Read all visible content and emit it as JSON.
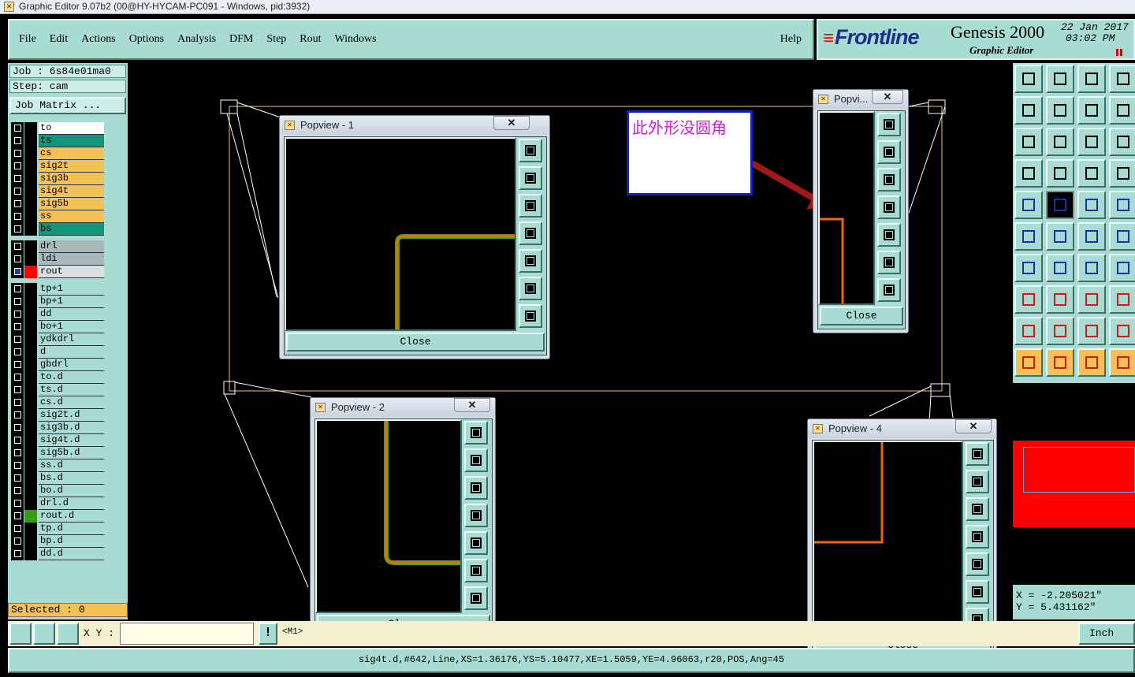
{
  "window_title": "Graphic Editor 9.07b2 (00@HY-HYCAM-PC091 - Windows, pid:3932)",
  "menu": [
    "File",
    "Edit",
    "Actions",
    "Options",
    "Analysis",
    "DFM",
    "Step",
    "Rout",
    "Windows"
  ],
  "help_label": "Help",
  "brand": {
    "logo": "Frontline",
    "product": "Genesis 2000",
    "subtitle": "Graphic Editor",
    "date": "22 Jan 2017",
    "time": "03:02 PM"
  },
  "job": {
    "job_label": "Job : 6s84e01ma0",
    "step_label": "Step: cam",
    "matrix_button": "Job Matrix ..."
  },
  "layers": [
    {
      "name": "to",
      "color": "#ffffff",
      "swatch": "#000000"
    },
    {
      "name": "ts",
      "color": "#14947a",
      "swatch": "#000000"
    },
    {
      "name": "cs",
      "color": "#f5c054",
      "swatch": "#000000"
    },
    {
      "name": "sig2t",
      "color": "#f5c054",
      "swatch": "#000000"
    },
    {
      "name": "sig3b",
      "color": "#f5c054",
      "swatch": "#000000"
    },
    {
      "name": "sig4t",
      "color": "#f5c054",
      "swatch": "#000000"
    },
    {
      "name": "sig5b",
      "color": "#f5c054",
      "swatch": "#000000"
    },
    {
      "name": "ss",
      "color": "#f5c054",
      "swatch": "#000000"
    },
    {
      "name": "bs",
      "color": "#14947a",
      "swatch": "#000000"
    },
    {
      "name": "drl",
      "color": "#a8b8b8",
      "swatch": "#000000"
    },
    {
      "name": "ldi",
      "color": "#a8b8b8",
      "swatch": "#000000"
    },
    {
      "name": "rout",
      "color": "#dedede",
      "swatch": "#ff0000"
    },
    {
      "name": "tp+1",
      "color": "#a8dcd2",
      "swatch": "#000000"
    },
    {
      "name": "bp+1",
      "color": "#a8dcd2",
      "swatch": "#000000"
    },
    {
      "name": "dd",
      "color": "#a8dcd2",
      "swatch": "#000000"
    },
    {
      "name": "bo+1",
      "color": "#a8dcd2",
      "swatch": "#000000"
    },
    {
      "name": "ydkdrl",
      "color": "#a8dcd2",
      "swatch": "#000000"
    },
    {
      "name": "d",
      "color": "#a8dcd2",
      "swatch": "#000000"
    },
    {
      "name": "gbdrl",
      "color": "#a8dcd2",
      "swatch": "#000000"
    },
    {
      "name": "to.d",
      "color": "#a8dcd2",
      "swatch": "#000000"
    },
    {
      "name": "ts.d",
      "color": "#a8dcd2",
      "swatch": "#000000"
    },
    {
      "name": "cs.d",
      "color": "#a8dcd2",
      "swatch": "#000000"
    },
    {
      "name": "sig2t.d",
      "color": "#a8dcd2",
      "swatch": "#000000"
    },
    {
      "name": "sig3b.d",
      "color": "#a8dcd2",
      "swatch": "#000000"
    },
    {
      "name": "sig4t.d",
      "color": "#a8dcd2",
      "swatch": "#000000"
    },
    {
      "name": "sig5b.d",
      "color": "#a8dcd2",
      "swatch": "#000000"
    },
    {
      "name": "ss.d",
      "color": "#a8dcd2",
      "swatch": "#000000"
    },
    {
      "name": "bs.d",
      "color": "#a8dcd2",
      "swatch": "#000000"
    },
    {
      "name": "bo.d",
      "color": "#a8dcd2",
      "swatch": "#000000"
    },
    {
      "name": "drl.d",
      "color": "#a8dcd2",
      "swatch": "#000000"
    },
    {
      "name": "rout.d",
      "color": "#a8dcd2",
      "swatch": "#3a9a18"
    },
    {
      "name": "tp.d",
      "color": "#a8dcd2",
      "swatch": "#000000"
    },
    {
      "name": "bp.d",
      "color": "#a8dcd2",
      "swatch": "#000000"
    },
    {
      "name": "dd.d",
      "color": "#a8dcd2",
      "swatch": "#000000"
    }
  ],
  "selected_label": "Selected : 0",
  "popviews": {
    "pv1_title": "Popview - 1",
    "pv2_title": "Popview - 2",
    "pv3_title": "Popvi...",
    "pv4_title": "Popview - 4",
    "close_label": "Close",
    "x_label": "✕"
  },
  "annotation_text": "此外形没圆角",
  "coords": {
    "x": "X = -2.205021\"",
    "y": "Y = 5.431162\""
  },
  "bottom": {
    "xy_label": "X Y :",
    "xy_value": "",
    "excl": "!",
    "mode": "<M1>",
    "units": "Inch"
  },
  "status_text": "sig4t.d,#642,Line,XS=1.36176,YS=5.10477,XE=1.5059,YE=4.96063,r20,POS,Ang=45",
  "colors": {
    "panel": "#a8dcd2",
    "trace": "#f06810",
    "trace_edge": "#20b020",
    "annotation_border": "#1020c0",
    "annotation_text": "#d01ad8"
  }
}
